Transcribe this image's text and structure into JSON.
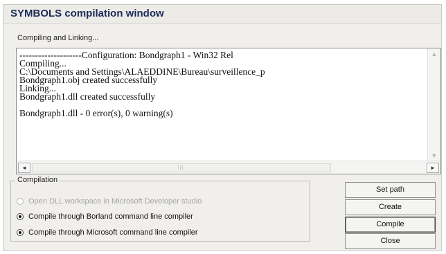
{
  "window": {
    "title": "SYMBOLS compilation window",
    "progress_label": "Compiling and Linking..."
  },
  "output": {
    "lines": [
      "--------------------Configuration: Bondgraph1 - Win32 Rel",
      "Compiling...",
      "C:\\Documents and Settings\\ALAEDDINE\\Bureau\\surveillence_p",
      "Bondgraph1.obj created successfully",
      "Linking...",
      "Bondgraph1.dll created successfully",
      "",
      "Bondgraph1.dll - 0 error(s), 0 warning(s)"
    ],
    "scroll": {
      "up": "▲",
      "down": "▼",
      "left": "◄",
      "right": "►",
      "grip": "|||"
    }
  },
  "compilation": {
    "label": "Compilation",
    "options": [
      {
        "label": "Open DLL workspace in Microsoft Developer studio",
        "checked": false,
        "disabled": true
      },
      {
        "label": "Compile through Borland command line compiler",
        "checked": true,
        "disabled": false
      },
      {
        "label": "Compile through Microsoft command line compiler",
        "checked": true,
        "disabled": false
      }
    ]
  },
  "buttons": {
    "set_path": "Set path",
    "create": "Create",
    "compile": "Compile",
    "close": "Close"
  }
}
